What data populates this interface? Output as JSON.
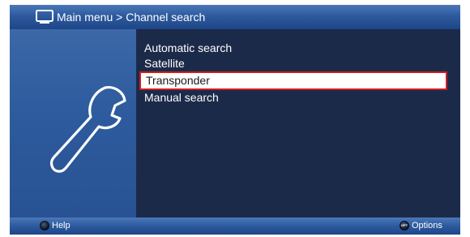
{
  "header": {
    "title": "Main menu > Channel search",
    "icon": "tv-icon"
  },
  "sidebar": {
    "icon": "wrench-icon"
  },
  "menu": {
    "items": [
      {
        "label": "Automatic search",
        "selected": false
      },
      {
        "label": "Satellite",
        "selected": false
      },
      {
        "label": "Transponder",
        "selected": true
      },
      {
        "label": "Manual search",
        "selected": false
      }
    ]
  },
  "footer": {
    "help_label": "Help",
    "options_label": "Options",
    "options_button_text": "OPT"
  },
  "colors": {
    "background": "#1c2a4a",
    "header": "#2d5a9e",
    "selection_border": "#d11d1d",
    "selection_fill": "#ffffff"
  }
}
